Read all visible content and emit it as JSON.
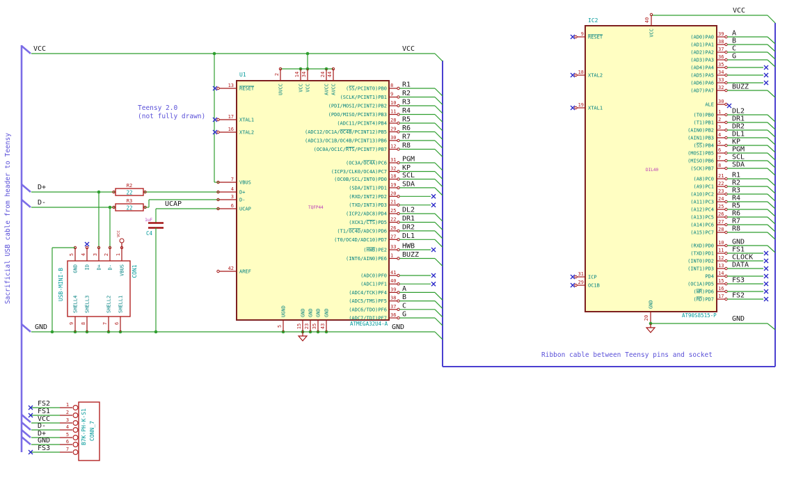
{
  "notes": {
    "teensy_line1": "Teensy 2.0",
    "teensy_line2": "(not fully drawn)",
    "left_cable": "Sacrificial USB cable from header to Teensy",
    "ribbon": "Ribbon cable between Teensy pins and socket"
  },
  "power": {
    "vcc": "VCC",
    "gnd": "GND"
  },
  "net_labels": {
    "dplus": "D+",
    "dminus": "D-",
    "ucap": "UCAP"
  },
  "colors": {
    "wire_green": "#2f9e2f",
    "pin_red": "#a31515",
    "ic_fill": "#fffec2",
    "ic_border": "#7d1f1f",
    "name_teal": "#008080",
    "ref_cyan": "#009999",
    "footprint_magenta": "#b836b8",
    "note_indigo": "#5a50d8",
    "cable_purple": "#7b6ce6",
    "box_blue": "#4a3fd0",
    "noconnect_blue": "#2a2ac8"
  },
  "u1": {
    "ref": "U1",
    "value": "ATMEGA32U4-A",
    "footprint": "TQFP44",
    "left_pins": [
      {
        "n": "13",
        "name": "~RESET~",
        "nc": true
      },
      {
        "n": "17",
        "name": "XTAL1",
        "nc": true
      },
      {
        "n": "16",
        "name": "XTAL2",
        "nc": true
      },
      {
        "n": "7",
        "name": "VBUS"
      },
      {
        "n": "4",
        "name": "D+"
      },
      {
        "n": "3",
        "name": "D-"
      },
      {
        "n": "6",
        "name": "UCAP"
      },
      {
        "n": "42",
        "name": "AREF"
      }
    ],
    "right_groups": [
      {
        "pins": [
          {
            "n": "8",
            "name": "(~SS~/PCINT0)PB0",
            "lbl": "R1"
          },
          {
            "n": "9",
            "name": "(SCLK/PCINT1)PB1",
            "lbl": "R2"
          },
          {
            "n": "10",
            "name": "(PDI/MOSI/PCINT2)PB2",
            "lbl": "R3"
          },
          {
            "n": "11",
            "name": "(PDO/MISO/PCINT3)PB3",
            "lbl": "R4"
          },
          {
            "n": "28",
            "name": "(ADC11/PCINT4)PB4",
            "lbl": "R5"
          },
          {
            "n": "29",
            "name": "(ADC12/OC1A/~OC4B~/PCINT12)PB5",
            "lbl": "R6"
          },
          {
            "n": "30",
            "name": "(ADC13/OC1B/OC4B/PCINT13)PB6",
            "lbl": "R7"
          },
          {
            "n": "12",
            "name": "(OC0A/OC1C/~RTS~/PCINT7)PB7",
            "lbl": "R8"
          }
        ]
      },
      {
        "pins": [
          {
            "n": "31",
            "name": "(OC3A/~OC4A~)PC6",
            "lbl": "PGM"
          },
          {
            "n": "32",
            "name": "(ICP3/CLK0/OC4A)PC7",
            "lbl": "KP"
          }
        ]
      },
      {
        "pins": [
          {
            "n": "18",
            "name": "(OC0B/SCL/INT0)PD0",
            "lbl": "SCL"
          },
          {
            "n": "19",
            "name": "(SDA/INT1)PD1",
            "lbl": "SDA"
          },
          {
            "n": "20",
            "name": "(RXD/INT2)PD2",
            "nc": true
          },
          {
            "n": "21",
            "name": "(TXD/INT3)PD3",
            "nc": true
          },
          {
            "n": "25",
            "name": "(ICP2/ADC8)PD4",
            "lbl": "DL2"
          },
          {
            "n": "22",
            "name": "(XCK1/~CTS~)PD5",
            "lbl": "DR1"
          },
          {
            "n": "26",
            "name": "(T1/~OC4D~/ADC9)PD6",
            "lbl": "DR2"
          },
          {
            "n": "27",
            "name": "(T0/OC4D/ADC10)PD7",
            "lbl": "DL1"
          }
        ]
      },
      {
        "pins": [
          {
            "n": "33",
            "name": "(~HWB~)PE2",
            "lbl": "HWB",
            "nc": true
          },
          {
            "n": "1",
            "name": "(INT6/AIN0)PE6",
            "lbl": "BUZZ"
          }
        ]
      },
      {
        "pins": [
          {
            "n": "41",
            "name": "(ADC0)PF0",
            "nc": true
          },
          {
            "n": "40",
            "name": "(ADC1)PF1",
            "nc": true
          },
          {
            "n": "39",
            "name": "(ADC4/TCK)PF4",
            "lbl": "A"
          },
          {
            "n": "38",
            "name": "(ADC5/TMS)PF5",
            "lbl": "B"
          },
          {
            "n": "37",
            "name": "(ADC6/TDO)PF6",
            "lbl": "C"
          },
          {
            "n": "36",
            "name": "(ADC7/TDI)PF7",
            "lbl": "G"
          }
        ]
      }
    ],
    "top_pins": [
      {
        "n": "2",
        "name": "UVCC"
      },
      {
        "n": "14",
        "name": "VCC"
      },
      {
        "n": "34",
        "name": "VCC"
      },
      {
        "n": "24",
        "name": "AVCC"
      },
      {
        "n": "44",
        "name": "AVCC"
      }
    ],
    "bottom_pins": [
      {
        "n": "5",
        "name": "UGND"
      },
      {
        "n": "15",
        "name": "GND"
      },
      {
        "n": "23",
        "name": "GND"
      },
      {
        "n": "35",
        "name": "GND"
      },
      {
        "n": "43",
        "name": "GND"
      }
    ]
  },
  "ic2": {
    "ref": "IC2",
    "value": "AT90S8515-P",
    "footprint": "DIL40",
    "left_pins": [
      {
        "n": "9",
        "name": "~RESET~",
        "nc": true
      },
      {
        "n": "18",
        "name": "XTAL2",
        "nc": true
      },
      {
        "n": "19",
        "name": "XTAL1",
        "nc": true
      },
      {
        "n": "31",
        "name": "ICP",
        "nc": true
      },
      {
        "n": "29",
        "name": "OC1B",
        "nc": true
      }
    ],
    "right_groups": [
      {
        "pins": [
          {
            "n": "39",
            "name": "(AD0)PA0",
            "lbl": "A"
          },
          {
            "n": "38",
            "name": "(AD1)PA1",
            "lbl": "B"
          },
          {
            "n": "37",
            "name": "(AD2)PA2",
            "lbl": "C"
          },
          {
            "n": "36",
            "name": "(AD3)PA3",
            "lbl": "G"
          },
          {
            "n": "35",
            "name": "(AD4)PA4",
            "nc": true
          },
          {
            "n": "34",
            "name": "(AD5)PA5",
            "nc": true
          },
          {
            "n": "33",
            "name": "(AD6)PA6",
            "nc": true
          },
          {
            "n": "32",
            "name": "(AD7)PA7",
            "lbl": "BUZZ"
          }
        ]
      },
      {
        "pins": [
          {
            "n": "30",
            "name": "ALE",
            "ncpin": true
          }
        ]
      },
      {
        "pins": [
          {
            "n": "1",
            "name": "(T0)PB0",
            "lbl": "DL2"
          },
          {
            "n": "2",
            "name": "(T1)PB1",
            "lbl": "DR1"
          },
          {
            "n": "3",
            "name": "(AIN0)PB2",
            "lbl": "DR2"
          },
          {
            "n": "4",
            "name": "(AIN1)PB3",
            "lbl": "DL1"
          },
          {
            "n": "5",
            "name": "(~SS~)PB4",
            "lbl": "KP"
          },
          {
            "n": "6",
            "name": "(MOSI)PB5",
            "lbl": "PGM"
          },
          {
            "n": "7",
            "name": "(MISO)PB6",
            "lbl": "SCL"
          },
          {
            "n": "8",
            "name": "(SCK)PB7",
            "lbl": "SDA"
          }
        ]
      },
      {
        "pins": [
          {
            "n": "21",
            "name": "(A8)PC0",
            "lbl": "R1"
          },
          {
            "n": "22",
            "name": "(A9)PC1",
            "lbl": "R2"
          },
          {
            "n": "23",
            "name": "(A10)PC2",
            "lbl": "R3"
          },
          {
            "n": "24",
            "name": "(A11)PC3",
            "lbl": "R4"
          },
          {
            "n": "25",
            "name": "(A12)PC4",
            "lbl": "R5"
          },
          {
            "n": "26",
            "name": "(A13)PC5",
            "lbl": "R6"
          },
          {
            "n": "27",
            "name": "(A14)PC6",
            "lbl": "R7"
          },
          {
            "n": "28",
            "name": "(A15)PC7",
            "lbl": "R8"
          }
        ]
      },
      {
        "pins": [
          {
            "n": "10",
            "name": "(RXD)PD0",
            "lbl": "GND"
          },
          {
            "n": "11",
            "name": "(TXD)PD1",
            "lbl": "FS1",
            "nc": true
          },
          {
            "n": "12",
            "name": "(INT0)PD2",
            "lbl": "CLOCK",
            "nc": true
          },
          {
            "n": "13",
            "name": "(INT1)PD3",
            "lbl": "DATA",
            "nc": true
          },
          {
            "n": "14",
            "name": "PD4",
            "nc": true
          },
          {
            "n": "15",
            "name": "(OC1A)PD5",
            "lbl": "FS3",
            "nc": true
          },
          {
            "n": "16",
            "name": "(~WR~)PD6",
            "nc": true
          },
          {
            "n": "17",
            "name": "(~RD~)PD7",
            "lbl": "FS2",
            "nc": true
          }
        ]
      }
    ],
    "top_pins": [
      {
        "n": "40",
        "name": "VCC"
      }
    ],
    "bottom_pins": [
      {
        "n": "20",
        "name": "GND"
      }
    ]
  },
  "con1": {
    "ref": "CON1",
    "value": "USB-MINI-B",
    "top_pins": [
      {
        "n": "5",
        "name": "GND"
      },
      {
        "n": "4",
        "name": "ID",
        "nc": true
      },
      {
        "n": "3",
        "name": "D+"
      },
      {
        "n": "2",
        "name": "D-"
      },
      {
        "n": "1",
        "name": "VBUS",
        "vcc": true
      }
    ],
    "bottom_pins": [
      {
        "n": "9",
        "name": "SHELL4"
      },
      {
        "n": "8",
        "name": "SHELL3"
      },
      {
        "n": "7",
        "name": "SHELL2"
      },
      {
        "n": "6",
        "name": "SHELL1"
      }
    ],
    "vbus_power_label": "VCC"
  },
  "conn7": {
    "value": "B7K-PH-K-S1",
    "name": "CONN_7",
    "rows": [
      {
        "lbl": "FS2",
        "n": "1",
        "nc": true
      },
      {
        "lbl": "FS1",
        "n": "2",
        "nc": true
      },
      {
        "lbl": "VCC",
        "n": "3"
      },
      {
        "lbl": "D-",
        "n": "4"
      },
      {
        "lbl": "D+",
        "n": "5"
      },
      {
        "lbl": "GND",
        "n": "6"
      },
      {
        "lbl": "FS3",
        "n": "7",
        "nc": true
      }
    ]
  },
  "r2": {
    "ref": "R2",
    "value": "22"
  },
  "r3": {
    "ref": "R3",
    "value": "22"
  },
  "c4": {
    "ref": "C4",
    "value": "1uF"
  }
}
